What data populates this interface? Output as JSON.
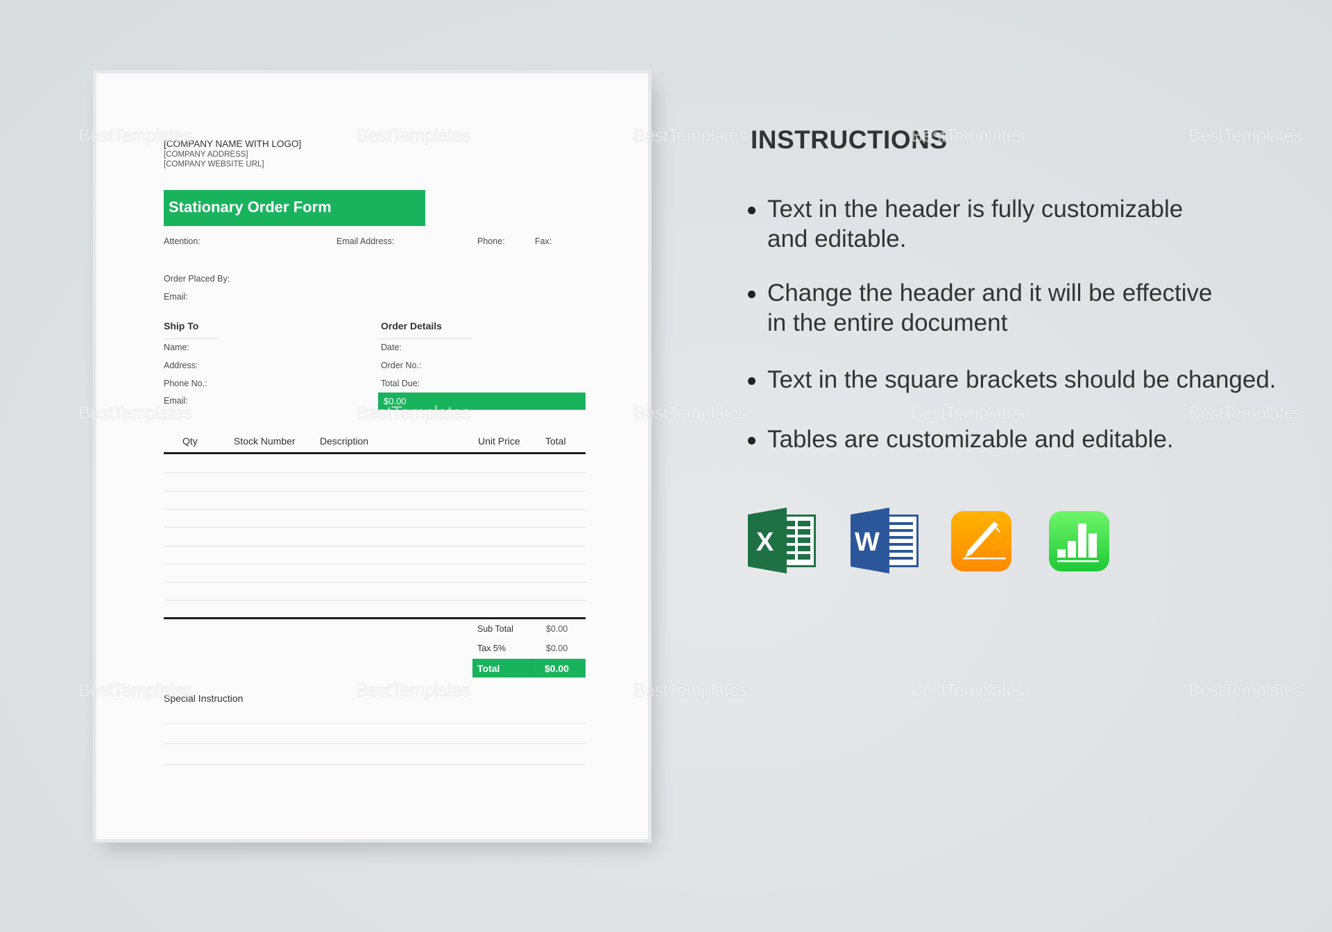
{
  "watermark_text": "BestTemplates",
  "document": {
    "company_name": "[COMPANY NAME WITH LOGO]",
    "company_address": "[COMPANY ADDRESS]",
    "company_url": "[COMPANY WEBSITE URL]",
    "title": "Stationary Order Form",
    "contact_fields": {
      "attention": "Attention:",
      "email_address": "Email Address:",
      "phone": "Phone:",
      "fax": "Fax:"
    },
    "order_placed_by": "Order Placed By:",
    "order_email": "Email:",
    "ship_to": {
      "heading": "Ship To",
      "fields": [
        "Name:",
        "Address:",
        "Phone No.:",
        "Email:"
      ]
    },
    "order_details": {
      "heading": "Order Details",
      "fields": [
        "Date:",
        "Order No.:",
        "Total Due:"
      ],
      "total_due_value": "$0.00"
    },
    "items_table": {
      "columns": [
        "Qty",
        "Stock Number",
        "Description",
        "Unit Price",
        "Total"
      ],
      "rows": [
        [
          "",
          "",
          "",
          "",
          ""
        ],
        [
          "",
          "",
          "",
          "",
          ""
        ],
        [
          "",
          "",
          "",
          "",
          ""
        ],
        [
          "",
          "",
          "",
          "",
          ""
        ],
        [
          "",
          "",
          "",
          "",
          ""
        ],
        [
          "",
          "",
          "",
          "",
          ""
        ],
        [
          "",
          "",
          "",
          "",
          ""
        ],
        [
          "",
          "",
          "",
          "",
          ""
        ],
        [
          "",
          "",
          "",
          "",
          ""
        ]
      ]
    },
    "totals": {
      "subtotal_label": "Sub Total",
      "subtotal_value": "$0.00",
      "tax_label": "Tax 5%",
      "tax_value": "$0.00",
      "total_label": "Total",
      "total_value": "$0.00"
    },
    "special_instruction_label": "Special Instruction",
    "accent_color": "#1ab35d"
  },
  "instructions": {
    "heading": "INSTRUCTIONS",
    "bullets": [
      {
        "line1": "Text in the header is fully customizable",
        "line2": "and editable."
      },
      {
        "line1": "Change the header and it will be effective",
        "line2": "in the entire document"
      },
      {
        "line1": "Text in the square brackets should be changed.",
        "line2": ""
      },
      {
        "line1": "Tables are customizable and editable.",
        "line2": ""
      }
    ]
  },
  "app_icons": [
    {
      "name": "excel-icon",
      "letter": "X",
      "color": "#1e7145"
    },
    {
      "name": "word-icon",
      "letter": "W",
      "color": "#2b579a"
    },
    {
      "name": "pages-icon",
      "letter": "",
      "color": "#ff9500"
    },
    {
      "name": "numbers-icon",
      "letter": "",
      "color": "#2fd34a"
    }
  ]
}
